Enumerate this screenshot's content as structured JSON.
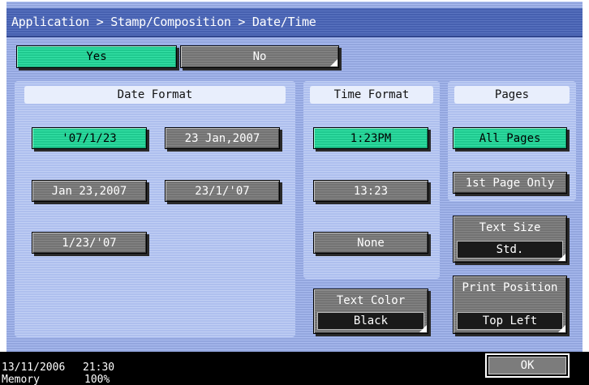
{
  "breadcrumb": "Application > Stamp/Composition > Date/Time",
  "toggle": {
    "yes_label": "Yes",
    "no_label": "No",
    "selected": "Yes"
  },
  "date_format": {
    "header": "Date Format",
    "options": [
      "'07/1/23",
      "23 Jan,2007",
      "Jan 23,2007",
      "23/1/'07",
      "1/23/'07"
    ],
    "selected": "'07/1/23"
  },
  "time_format": {
    "header": "Time Format",
    "options": [
      "1:23PM",
      "13:23",
      "None"
    ],
    "selected": "1:23PM"
  },
  "pages": {
    "header": "Pages",
    "options": [
      "All Pages",
      "1st Page Only"
    ],
    "selected": "All Pages"
  },
  "text_size": {
    "label": "Text Size",
    "value": "Std."
  },
  "text_color": {
    "label": "Text Color",
    "value": "Black"
  },
  "print_position": {
    "label": "Print Position",
    "value": "Top Left"
  },
  "ok_label": "OK",
  "status": {
    "date": "13/11/2006",
    "time": "21:30",
    "memory_label": "Memory",
    "memory_value": "100%"
  },
  "colors": {
    "selected": "#27d49a",
    "button": "#7c7c7c",
    "panel": "#b7c7f0",
    "background": "#9fb1e6",
    "title_bar": "#4f6ab8"
  }
}
